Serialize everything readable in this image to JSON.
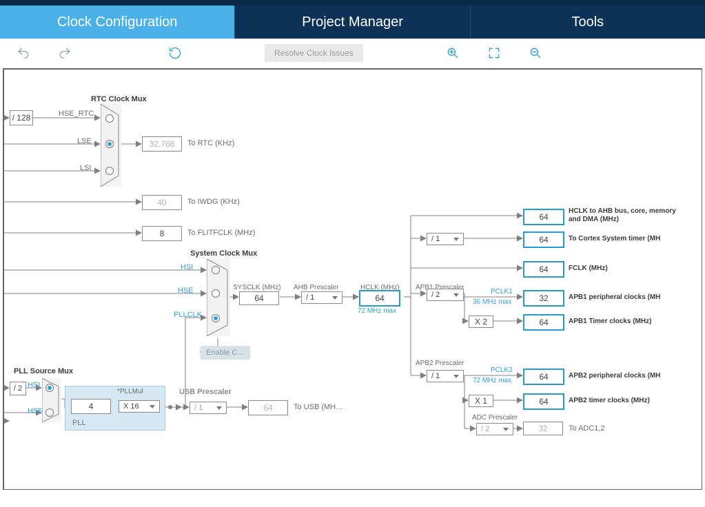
{
  "tabs": {
    "active": "Clock Configuration",
    "pm": "Project Manager",
    "tools": "Tools"
  },
  "toolbar": {
    "resolve": "Resolve Clock Issues"
  },
  "rtc": {
    "title": "RTC Clock Mux",
    "div": "/ 128",
    "hse": "HSE_RTC",
    "lse": "LSE",
    "lsi": "LSI",
    "val": "32.768",
    "to": "To RTC (KHz)"
  },
  "iwdg": {
    "val": "40",
    "to": "To IWDG (KHz)"
  },
  "flitf": {
    "val": "8",
    "to": "To FLITFCLK (MHz)"
  },
  "sys": {
    "title": "System Clock Mux",
    "hsi": "HSI",
    "hse": "HSE",
    "pllclk": "PLLCLK",
    "enable": "Enable C…",
    "sysclk_lbl": "SYSCLK (MHz)",
    "sysclk": "64",
    "ahb_lbl": "AHB Prescaler",
    "ahb": "/ 1",
    "hclk_lbl": "HCLK (MHz)",
    "hclk": "64",
    "hclk_note": "72 MHz max"
  },
  "pll": {
    "title": "PLL Source Mux",
    "hsi": "HSI",
    "hse": "HSE",
    "div": "/ 2",
    "pll_lbl": "PLL",
    "mul_lbl": "*PLLMul",
    "n": "4",
    "mul": "X 16"
  },
  "usb": {
    "title": "USB Prescaler",
    "div": "/ 1",
    "val": "64",
    "to": "To USB (MH…"
  },
  "apb1": {
    "title": "APB1 Prescaler",
    "div": "/ 2",
    "x": "X 2",
    "pclk": "PCLK1",
    "note": "36 MHz max"
  },
  "apb2": {
    "title": "APB2 Prescaler",
    "div": "/ 1",
    "x": "X 1",
    "pclk": "PCLK2",
    "note": "72 MHz max"
  },
  "cortex": {
    "div": "/ 1"
  },
  "adc": {
    "title": "ADC Prescaler",
    "div": "/ 2",
    "val": "32",
    "to": "To ADC1,2"
  },
  "out": {
    "hclk_bus": {
      "v": "64",
      "t": "HCLK to AHB bus, core, memory and DMA (MHz)"
    },
    "cortex": {
      "v": "64",
      "t": "To Cortex System timer (MH"
    },
    "fclk": {
      "v": "64",
      "t": "FCLK (MHz)"
    },
    "apb1p": {
      "v": "32",
      "t": "APB1 peripheral clocks (MH"
    },
    "apb1t": {
      "v": "64",
      "t": "APB1 Timer clocks (MHz)"
    },
    "apb2p": {
      "v": "64",
      "t": "APB2 peripheral clocks (MH"
    },
    "apb2t": {
      "v": "64",
      "t": "APB2 timer clocks (MHz)"
    }
  }
}
